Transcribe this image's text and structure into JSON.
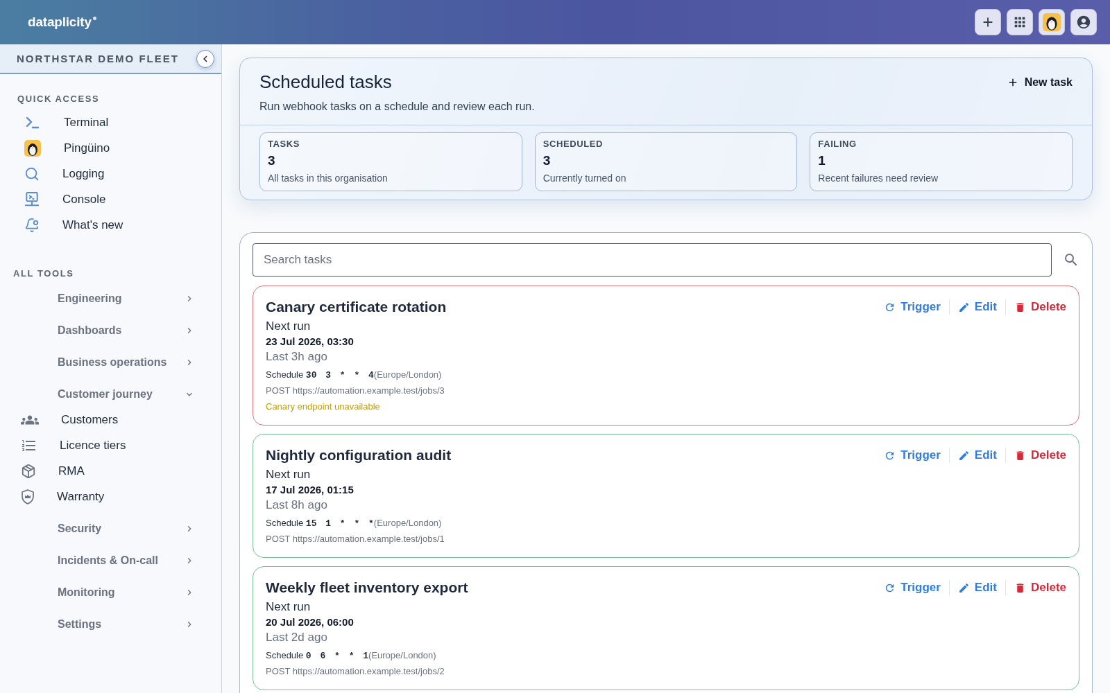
{
  "header": {
    "logo": "dataplicity"
  },
  "sidebar": {
    "org": "NORTHSTAR DEMO FLEET",
    "quick_access": {
      "title": "QUICK ACCESS",
      "items": [
        {
          "label": "Terminal"
        },
        {
          "label": "Pingüino"
        },
        {
          "label": "Logging"
        },
        {
          "label": "Console"
        },
        {
          "label": "What's new"
        }
      ]
    },
    "all_tools": {
      "title": "ALL TOOLS",
      "groups": [
        {
          "label": "Engineering",
          "expanded": false
        },
        {
          "label": "Dashboards",
          "expanded": false
        },
        {
          "label": "Business operations",
          "expanded": false
        },
        {
          "label": "Customer journey",
          "expanded": true,
          "children": [
            {
              "label": "Customers"
            },
            {
              "label": "Licence tiers"
            },
            {
              "label": "RMA"
            },
            {
              "label": "Warranty"
            }
          ]
        },
        {
          "label": "Security",
          "expanded": false
        },
        {
          "label": "Incidents & On-call",
          "expanded": false
        },
        {
          "label": "Monitoring",
          "expanded": false
        },
        {
          "label": "Settings",
          "expanded": false
        }
      ]
    }
  },
  "page": {
    "title": "Scheduled tasks",
    "subtitle": "Run webhook tasks on a schedule and review each run.",
    "new_task": "New task",
    "stats": [
      {
        "label": "TASKS",
        "value": "3",
        "note": "All tasks in this organisation"
      },
      {
        "label": "SCHEDULED",
        "value": "3",
        "note": "Currently turned on"
      },
      {
        "label": "FAILING",
        "value": "1",
        "note": "Recent failures need review"
      }
    ]
  },
  "tasks": {
    "search": {
      "placeholder": "Search tasks"
    },
    "items": [
      {
        "name": "Canary certificate rotation",
        "failing": true,
        "next_run_label": "Next run",
        "next_run": "23 Jul 2026, 03:30",
        "last_run": "Last 3h ago",
        "schedule": {
          "label": "Schedule",
          "cron": "30 3 * * 4",
          "timezone": "(Europe/London)"
        },
        "request": "POST https://automation.example.test/jobs/3",
        "error": "Canary endpoint unavailable",
        "actions": [
          {
            "kind": "trigger",
            "label": "Trigger"
          },
          {
            "kind": "edit",
            "label": "Edit"
          },
          {
            "kind": "delete",
            "label": "Delete"
          }
        ]
      },
      {
        "name": "Nightly configuration audit",
        "failing": false,
        "next_run_label": "Next run",
        "next_run": "17 Jul 2026, 01:15",
        "last_run": "Last 8h ago",
        "schedule": {
          "label": "Schedule",
          "cron": "15 1 * * *",
          "timezone": "(Europe/London)"
        },
        "request": "POST https://automation.example.test/jobs/1",
        "actions": [
          {
            "kind": "trigger",
            "label": "Trigger"
          },
          {
            "kind": "edit",
            "label": "Edit"
          },
          {
            "kind": "delete",
            "label": "Delete"
          }
        ]
      },
      {
        "name": "Weekly fleet inventory export",
        "failing": false,
        "next_run_label": "Next run",
        "next_run": "20 Jul 2026, 06:00",
        "last_run": "Last 2d ago",
        "schedule": {
          "label": "Schedule",
          "cron": "0 6 * * 1",
          "timezone": "(Europe/London)"
        },
        "request": "POST https://automation.example.test/jobs/2",
        "actions": [
          {
            "kind": "trigger",
            "label": "Trigger"
          },
          {
            "kind": "edit",
            "label": "Edit"
          },
          {
            "kind": "delete",
            "label": "Delete"
          }
        ]
      }
    ]
  }
}
